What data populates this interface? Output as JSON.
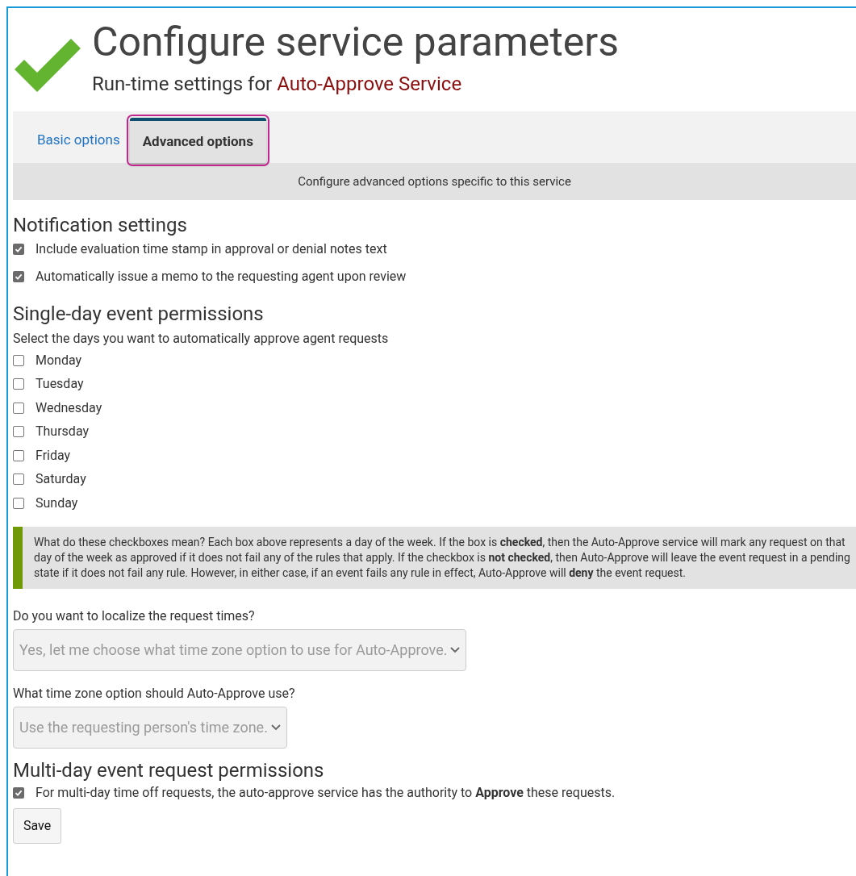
{
  "header": {
    "title": "Configure service parameters",
    "subtitle": "Run-time settings for ",
    "service_name": "Auto-Approve Service"
  },
  "tabs": [
    {
      "label": "Basic options",
      "selected": false,
      "highlighted": false
    },
    {
      "label": "Advanced options",
      "selected": true,
      "highlighted": true
    }
  ],
  "tab_description": "Configure advanced options specific to this service",
  "notification_settings": {
    "heading": "Notification settings",
    "options": [
      {
        "label": "Include evaluation time stamp in approval or denial notes text",
        "checked": true
      },
      {
        "label": "Automatically issue a memo to the requesting agent upon review",
        "checked": true
      }
    ]
  },
  "single_day": {
    "heading": "Single-day event permissions",
    "instruction": "Select the days you want to automatically approve agent requests",
    "days": [
      {
        "label": "Monday",
        "checked": false
      },
      {
        "label": "Tuesday",
        "checked": false
      },
      {
        "label": "Wednesday",
        "checked": false
      },
      {
        "label": "Thursday",
        "checked": false
      },
      {
        "label": "Friday",
        "checked": false
      },
      {
        "label": "Saturday",
        "checked": false
      },
      {
        "label": "Sunday",
        "checked": false
      }
    ]
  },
  "note": "What do these checkboxes mean? Each box above represents a day of the week. If the box is **checked**, then the Auto-Approve service will mark any request on that day of the week as approved if it does not fail any of the rules that apply. If the checkbox is **not checked**, then Auto-Approve will leave the event request in a pending state if it does not fail any rule. However, in either case, if an event fails any rule in effect, Auto-Approve will **deny** the event request.",
  "selects": [
    {
      "label": "Do you want to localize the request times?",
      "value": "Yes, let me choose what time zone option to use for Auto-Approve.",
      "disabled": true
    },
    {
      "label": "What time zone option should Auto-Approve use?",
      "value": "Use the requesting person's time zone.",
      "disabled": true
    }
  ],
  "multi_day": {
    "heading": "Multi-day event request permissions",
    "options": [
      {
        "label": "For multi-day time off requests, the auto-approve service has the authority to **Approve** these requests.",
        "checked": true
      }
    ]
  },
  "save_button": "Save"
}
